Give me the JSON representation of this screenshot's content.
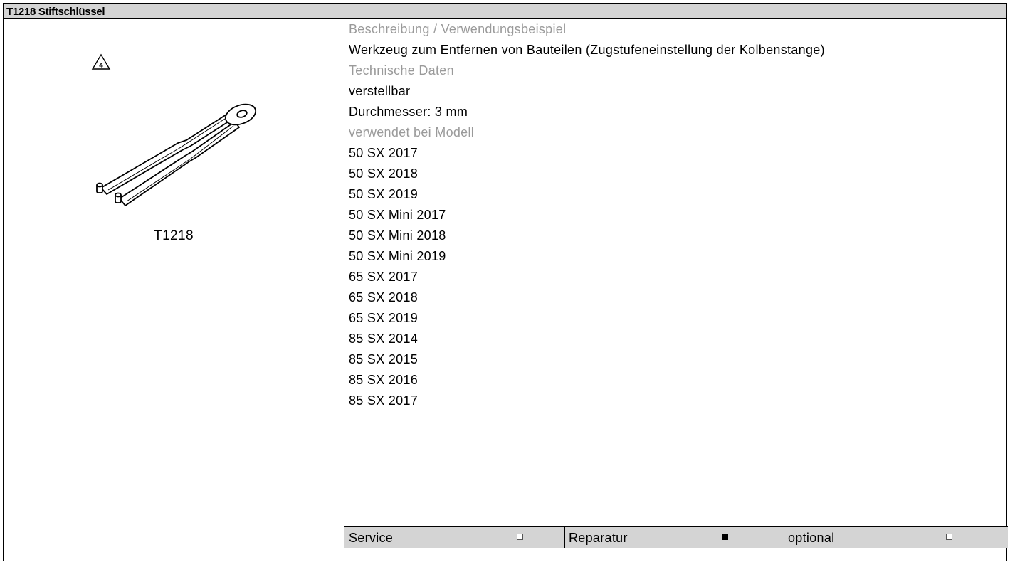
{
  "title": "T1218 Stiftschlüssel",
  "left": {
    "warning_icon_number": "4",
    "tool_code": "T1218"
  },
  "sections": [
    {
      "text": "Beschreibung / Verwendungsbeispiel",
      "heading": true
    },
    {
      "text": "Werkzeug zum Entfernen von Bauteilen (Zugstufeneinstellung der Kolbenstange)",
      "heading": false
    },
    {
      "text": "Technische Daten",
      "heading": true
    },
    {
      "text": "verstellbar",
      "heading": false
    },
    {
      "text": "Durchmesser: 3 mm",
      "heading": false
    },
    {
      "text": "verwendet bei Modell",
      "heading": true
    },
    {
      "text": "50 SX 2017",
      "heading": false
    },
    {
      "text": "50 SX 2018",
      "heading": false
    },
    {
      "text": "50 SX 2019",
      "heading": false
    },
    {
      "text": "50 SX Mini 2017",
      "heading": false
    },
    {
      "text": "50 SX Mini 2018",
      "heading": false
    },
    {
      "text": "50 SX Mini 2019",
      "heading": false
    },
    {
      "text": "65 SX 2017",
      "heading": false
    },
    {
      "text": "65 SX 2018",
      "heading": false
    },
    {
      "text": "65 SX 2019",
      "heading": false
    },
    {
      "text": "85 SX 2014",
      "heading": false
    },
    {
      "text": "85 SX 2015",
      "heading": false
    },
    {
      "text": "85 SX 2016",
      "heading": false
    },
    {
      "text": "85 SX 2017",
      "heading": false
    }
  ],
  "footer": [
    {
      "label": "Service",
      "checked": false
    },
    {
      "label": "Reparatur",
      "checked": true
    },
    {
      "label": "optional",
      "checked": false
    }
  ],
  "colors": {
    "header_bg": "#d4d4d4",
    "heading_text": "#9a9a9a"
  }
}
